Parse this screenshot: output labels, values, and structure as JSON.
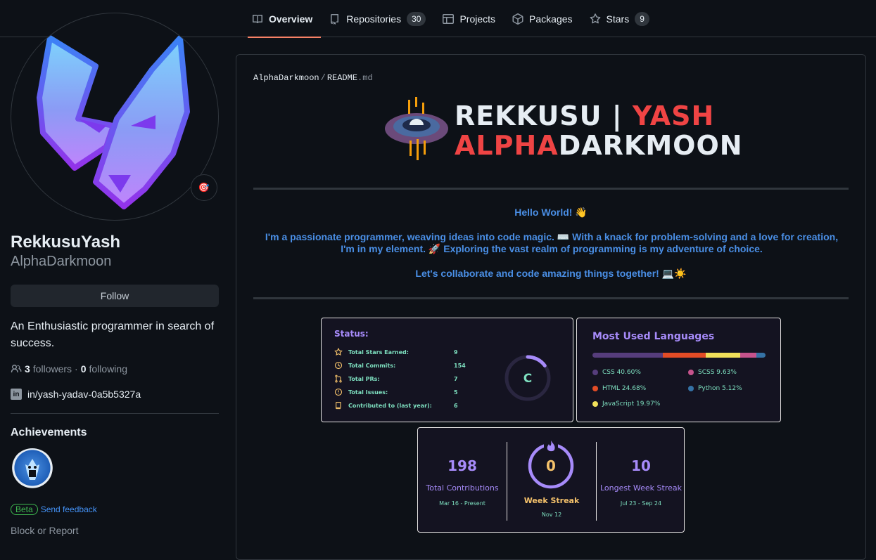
{
  "nav": {
    "tabs": [
      {
        "label": "Overview",
        "count": null
      },
      {
        "label": "Repositories",
        "count": "30"
      },
      {
        "label": "Projects",
        "count": null
      },
      {
        "label": "Packages",
        "count": null
      },
      {
        "label": "Stars",
        "count": "9"
      }
    ]
  },
  "profile": {
    "fullname": "RekkusuYash",
    "username": "AlphaDarkmoon",
    "status_emoji": "🎯",
    "follow_label": "Follow",
    "bio": "An Enthusiastic programmer in search of success.",
    "followers_count": "3",
    "followers_label": "followers",
    "following_count": "0",
    "following_label": "following",
    "linkedin": "in/yash-yadav-0a5b5327a",
    "achievements_title": "Achievements",
    "beta_label": "Beta",
    "feedback_label": "Send feedback",
    "block_label": "Block or Report"
  },
  "readme": {
    "path_owner": "AlphaDarkmoon",
    "path_file": "README",
    "path_ext": ".md",
    "banner": {
      "line1_white": "REKKUSU | ",
      "line1_red": "YASH",
      "line2_red": "ALPHA",
      "line2_white": "DARKMOON"
    },
    "hello": "Hello World! 👋",
    "para": "I'm a passionate programmer, weaving ideas into code magic. ⌨️ With a knack for problem-solving and a love for creation, I'm in my element. 🚀 Exploring the vast realm of programming is my adventure of choice.",
    "collab": "Let's collaborate and code amazing things together! 💻☀️"
  },
  "stats_card": {
    "title": "Status:",
    "rows": [
      {
        "label": "Total Stars Earned:",
        "value": "9"
      },
      {
        "label": "Total Commits:",
        "value": "154"
      },
      {
        "label": "Total PRs:",
        "value": "7"
      },
      {
        "label": "Total Issues:",
        "value": "5"
      },
      {
        "label": "Contributed to (last year):",
        "value": "6"
      }
    ],
    "grade": "C",
    "grade_fraction": 0.15
  },
  "langs_card": {
    "title": "Most Used Languages",
    "langs": [
      {
        "label": "CSS 40.60%",
        "percent": 40.6,
        "color": "#563d7c"
      },
      {
        "label": "HTML 24.68%",
        "percent": 24.68,
        "color": "#e34c26"
      },
      {
        "label": "JavaScript 19.97%",
        "percent": 19.97,
        "color": "#f1e05a"
      },
      {
        "label": "SCSS 9.63%",
        "percent": 9.63,
        "color": "#c6538c"
      },
      {
        "label": "Python 5.12%",
        "percent": 5.12,
        "color": "#3572a5"
      }
    ]
  },
  "streak_card": {
    "total": "198",
    "total_label": "Total Contributions",
    "total_range": "Mar 16 - Present",
    "current": "0",
    "current_label": "Week Streak",
    "current_date": "Nov 12",
    "longest": "10",
    "longest_label": "Longest Week Streak",
    "longest_range": "Jul 23 - Sep 24"
  },
  "colors": {
    "accent_tab": "#f78166",
    "link": "#4493f8",
    "card_bg": "#141321",
    "card_title": "#a78bfa",
    "card_text": "#7ee0c0",
    "icon": "#f5c26b"
  }
}
